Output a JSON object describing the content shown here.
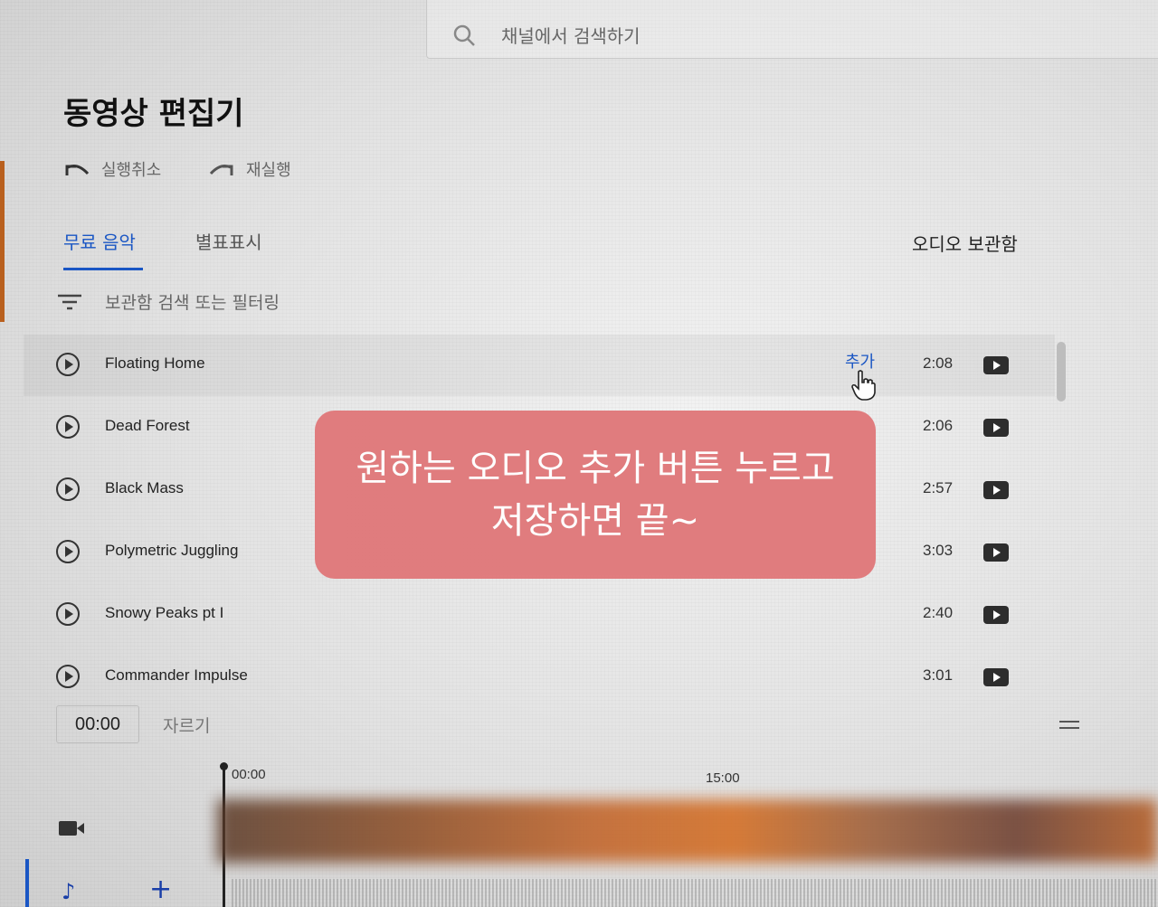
{
  "search": {
    "placeholder_text": "채널에서 검색하기"
  },
  "page": {
    "title": "동영상 편집기"
  },
  "toolbar": {
    "undo_label": "실행취소",
    "redo_label": "재실행"
  },
  "tabs": [
    {
      "label": "무료 음악",
      "active": true
    },
    {
      "label": "별표표시",
      "active": false
    }
  ],
  "library_label": "오디오 보관함",
  "filter": {
    "placeholder_text": "보관함 검색 또는 필터링"
  },
  "tracks": [
    {
      "name": "Floating Home",
      "duration": "2:08",
      "action": "추가"
    },
    {
      "name": "Dead Forest",
      "duration": "2:06"
    },
    {
      "name": "Black Mass",
      "duration": "2:57"
    },
    {
      "name": "Polymetric Juggling",
      "duration": "3:03"
    },
    {
      "name": "Snowy Peaks pt I",
      "duration": "2:40"
    },
    {
      "name": "Commander Impulse",
      "duration": "3:01"
    }
  ],
  "callout": {
    "line1": "원하는 오디오 추가 버튼 누르고",
    "line2": "저장하면 끝~"
  },
  "timeline": {
    "current_time": "00:00",
    "trim_label": "자르기",
    "marker_start": "00:00",
    "marker_mid": "15:00"
  },
  "colors": {
    "accent": "#1a56c4",
    "callout_bg": "#e0787a"
  }
}
